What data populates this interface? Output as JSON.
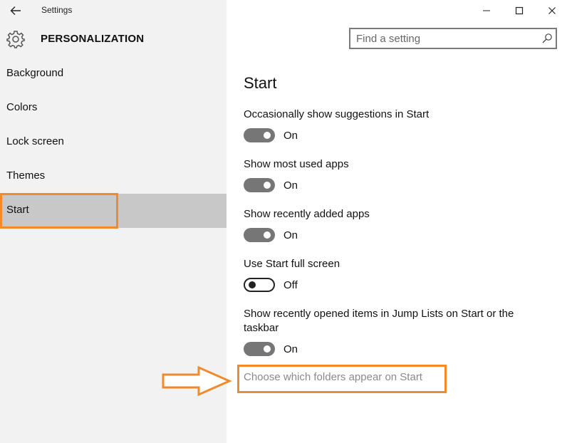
{
  "window": {
    "title": "Settings"
  },
  "header": {
    "section_title": "PERSONALIZATION",
    "search_placeholder": "Find a setting"
  },
  "sidebar": {
    "items": [
      {
        "label": "Background",
        "selected": false
      },
      {
        "label": "Colors",
        "selected": false
      },
      {
        "label": "Lock screen",
        "selected": false
      },
      {
        "label": "Themes",
        "selected": false
      },
      {
        "label": "Start",
        "selected": true
      }
    ]
  },
  "main": {
    "heading": "Start",
    "settings": [
      {
        "label": "Occasionally show suggestions in Start",
        "state": "On",
        "on": true
      },
      {
        "label": "Show most used apps",
        "state": "On",
        "on": true
      },
      {
        "label": "Show recently added apps",
        "state": "On",
        "on": true
      },
      {
        "label": "Use Start full screen",
        "state": "Off",
        "on": false
      },
      {
        "label": "Show recently opened items in Jump Lists on Start or the taskbar",
        "state": "On",
        "on": true
      }
    ],
    "folders_link": "Choose which folders appear on Start"
  },
  "colors": {
    "annotation": "#f08a2c",
    "sidebar_bg": "#f2f2f2",
    "selected_bg": "#c8c8c8",
    "toggle_on": "#767676"
  },
  "icons": {
    "back": "back-arrow-icon",
    "minimize": "minimize-icon",
    "maximize": "maximize-icon",
    "close": "close-icon",
    "settings": "gear-icon",
    "search": "search-icon",
    "annotation": "arrow-right-icon"
  }
}
